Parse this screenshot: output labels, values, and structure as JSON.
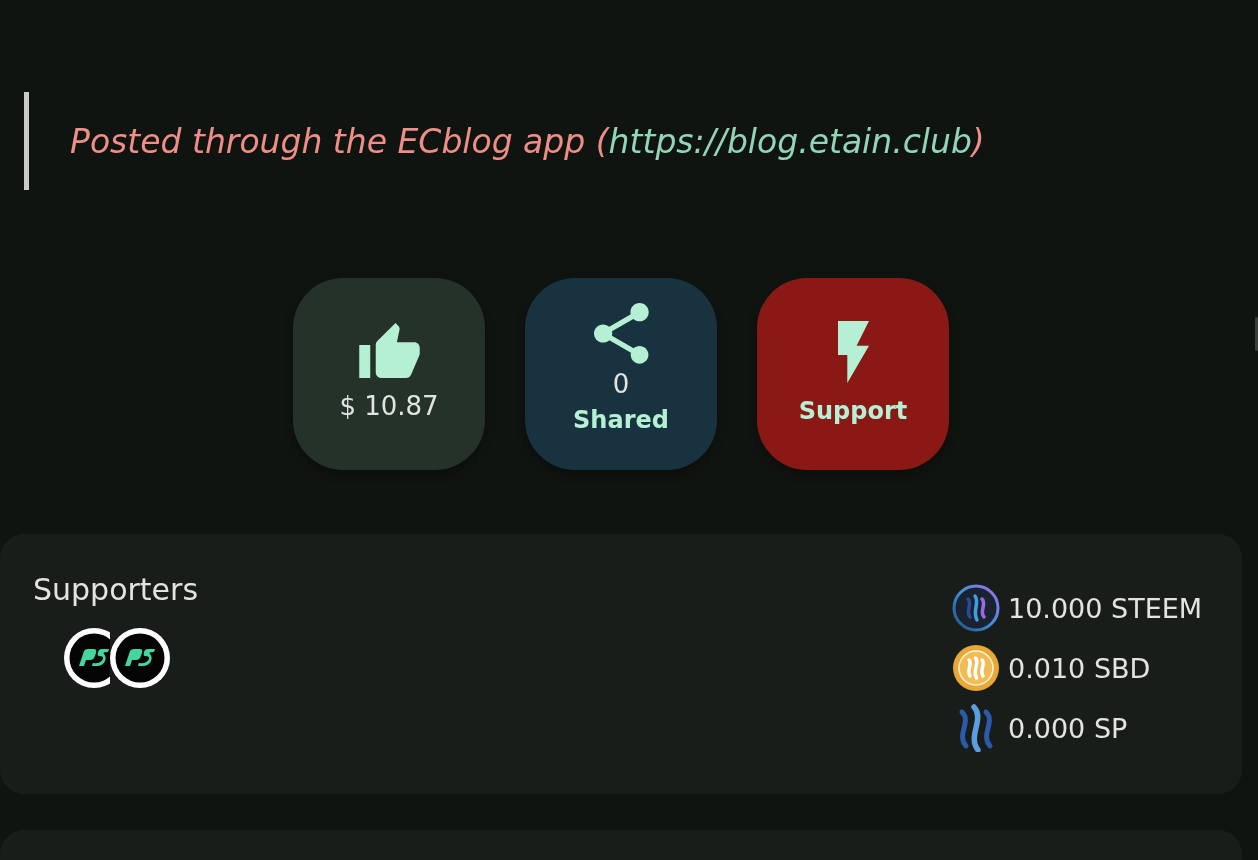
{
  "quote": {
    "text": "Posted through the ECblog app (",
    "link": "https://blog.etain.club",
    "closing": ")"
  },
  "actions": [
    {
      "kind": "like",
      "value": "$ 10.87"
    },
    {
      "kind": "share",
      "count": "0",
      "label": "Shared"
    },
    {
      "kind": "support",
      "label": "Support"
    }
  ],
  "supporters": {
    "title": "Supporters",
    "avatars": [
      {
        "kind": "logo"
      },
      {
        "kind": "logo"
      }
    ]
  },
  "amounts": [
    {
      "kind": "steem",
      "text": "10.000 STEEM"
    },
    {
      "kind": "sbd",
      "text": "0.010 SBD"
    },
    {
      "kind": "sp",
      "text": "0.000 SP"
    }
  ]
}
